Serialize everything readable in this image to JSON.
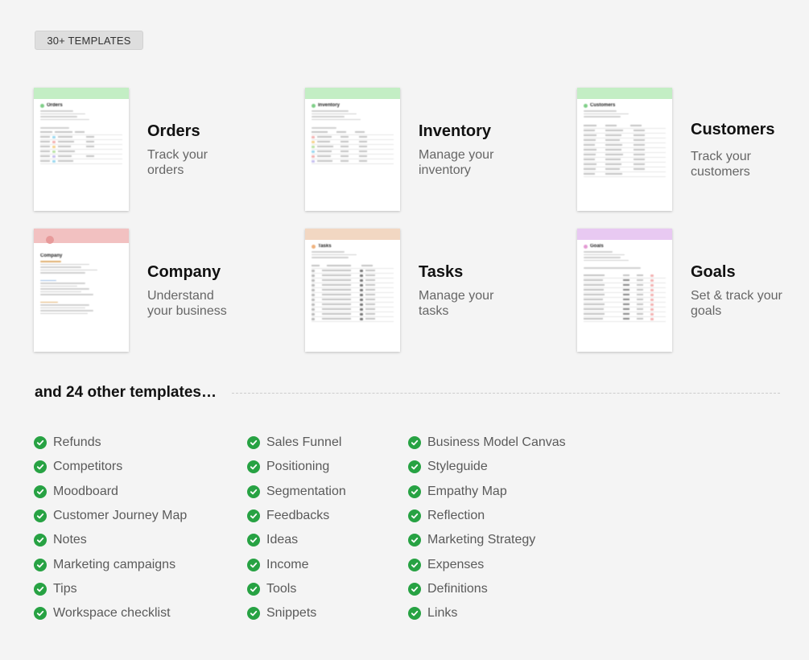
{
  "badge": "30+ TEMPLATES",
  "accent_color": "#27a243",
  "templates": [
    {
      "title": "Orders",
      "description": "Track your orders",
      "thumb_color": "#c3eec4",
      "thumb_title": "Orders"
    },
    {
      "title": "Inventory",
      "description": "Manage your inventory",
      "thumb_color": "#c3eec4",
      "thumb_title": "Inventory"
    },
    {
      "title": "Customers",
      "description": "Track your customers",
      "thumb_color": "#c3eec4",
      "thumb_title": "Customers"
    },
    {
      "title": "Company",
      "description": "Understand your business",
      "thumb_color": "#f2c1c1",
      "thumb_title": "Company"
    },
    {
      "title": "Tasks",
      "description": "Manage your tasks",
      "thumb_color": "#f2d7c2",
      "thumb_title": "Tasks"
    },
    {
      "title": "Goals",
      "description": "Set & track your goals",
      "thumb_color": "#e8c9f2",
      "thumb_title": "Goals"
    }
  ],
  "other_templates": {
    "heading": "and 24 other templates…",
    "columns": [
      [
        "Refunds",
        "Competitors",
        "Moodboard",
        "Customer Journey Map",
        "Notes",
        "Marketing campaigns",
        "Tips",
        "Workspace checklist"
      ],
      [
        "Sales Funnel",
        "Positioning",
        "Segmentation",
        "Feedbacks",
        "Ideas",
        "Income",
        "Tools",
        "Snippets"
      ],
      [
        "Business Model Canvas",
        "Styleguide",
        "Empathy Map",
        "Reflection",
        "Marketing Strategy",
        "Expenses",
        "Definitions",
        "Links"
      ]
    ]
  }
}
